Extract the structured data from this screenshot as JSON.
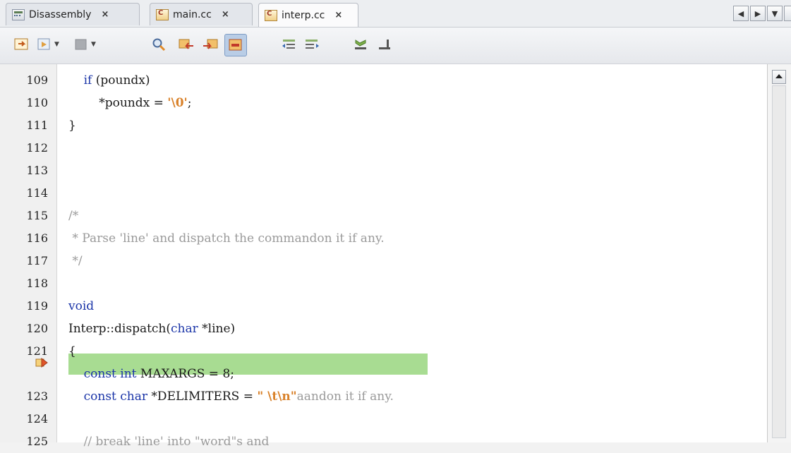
{
  "tabs": [
    {
      "label": "Disassembly",
      "icon": "disassembly-icon",
      "close": "×",
      "active": false
    },
    {
      "label": "main.cc",
      "icon": "cc-file-icon",
      "close": "×",
      "active": false
    },
    {
      "label": "interp.cc",
      "icon": "cc-file-icon",
      "close": "×",
      "active": true
    }
  ],
  "tab_nav": {
    "left": "◀",
    "right": "▶",
    "menu": "▼"
  },
  "toolbar": {
    "icons": [
      "back-icon",
      "run-icon",
      "stop-icon",
      "find-icon",
      "prev-bookmark-icon",
      "next-bookmark-icon",
      "toggle-bookmark-icon",
      "shift-left-icon",
      "shift-right-icon",
      "macro-icon",
      "comment-icon"
    ]
  },
  "editor": {
    "lines": [
      {
        "num": "109",
        "segments": [
          {
            "t": "    ",
            "c": ""
          },
          {
            "t": "if",
            "c": "kw"
          },
          {
            "t": " (poundx)",
            "c": ""
          }
        ]
      },
      {
        "num": "110",
        "segments": [
          {
            "t": "        *poundx = ",
            "c": ""
          },
          {
            "t": "'\\0'",
            "c": "str"
          },
          {
            "t": ";",
            "c": ""
          }
        ]
      },
      {
        "num": "111",
        "segments": [
          {
            "t": "}",
            "c": ""
          }
        ]
      },
      {
        "num": "112",
        "segments": []
      },
      {
        "num": "113",
        "segments": []
      },
      {
        "num": "114",
        "segments": []
      },
      {
        "num": "115",
        "segments": [
          {
            "t": "/*",
            "c": "cm"
          }
        ]
      },
      {
        "num": "116",
        "segments": [
          {
            "t": " * Parse 'line' and dispatch the commandon it if any.",
            "c": "cm"
          }
        ]
      },
      {
        "num": "117",
        "segments": [
          {
            "t": " */",
            "c": "cm"
          }
        ]
      },
      {
        "num": "118",
        "segments": []
      },
      {
        "num": "119",
        "segments": [
          {
            "t": "void",
            "c": "kw"
          }
        ]
      },
      {
        "num": "120",
        "segments": [
          {
            "t": "Interp::dispatch(",
            "c": ""
          },
          {
            "t": "char",
            "c": "kw"
          },
          {
            "t": " *line)",
            "c": ""
          }
        ]
      },
      {
        "num": "121",
        "segments": [
          {
            "t": "{",
            "c": ""
          }
        ]
      },
      {
        "num": "",
        "current": true,
        "segments": [
          {
            "t": "    ",
            "c": ""
          },
          {
            "t": "const int",
            "c": "kw"
          },
          {
            "t": " MAXARGS = 8;",
            "c": ""
          }
        ]
      },
      {
        "num": "123",
        "segments": [
          {
            "t": "    ",
            "c": ""
          },
          {
            "t": "const char",
            "c": "kw"
          },
          {
            "t": " *DELIMITERS = ",
            "c": ""
          },
          {
            "t": "\" \\t\\n\"",
            "c": "str"
          },
          {
            "t": "aandon it if any.",
            "c": "cm"
          }
        ]
      },
      {
        "num": "124",
        "segments": []
      },
      {
        "num": "125",
        "segments": [
          {
            "t": "    // break 'line' into \"word\"s and",
            "c": "cm"
          }
        ]
      }
    ]
  },
  "colors": {
    "keyword": "#1b35a8",
    "string": "#d9822b",
    "comment": "#9a9a9a",
    "current_line": "#a8dc92"
  }
}
